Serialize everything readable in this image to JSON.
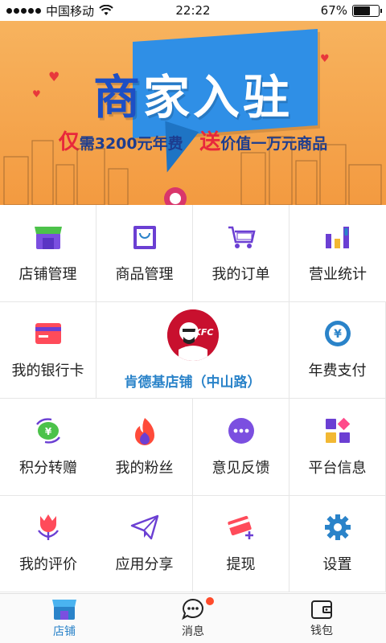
{
  "status_bar": {
    "carrier": "中国移动",
    "time": "22:22",
    "battery": "67%",
    "battery_level": 0.67
  },
  "banner": {
    "title_first": "商",
    "title_rest": "家入驻",
    "sub_mark1": "仅",
    "sub_text1": "需3200元年费",
    "sub_mark2": "送",
    "sub_text2": "价值一万元商品"
  },
  "grid": {
    "store_manage": "店铺管理",
    "goods_manage": "商品管理",
    "my_orders": "我的订单",
    "business_stats": "营业统计",
    "bank_card": "我的银行卡",
    "store_name": "肯德基店铺（中山路）",
    "store_logo_text": "KFC",
    "annual_fee": "年费支付",
    "points_transfer": "积分转赠",
    "my_fans": "我的粉丝",
    "feedback": "意见反馈",
    "platform_info": "平台信息",
    "my_reviews": "我的评价",
    "app_share": "应用分享",
    "withdraw": "提现",
    "settings": "设置"
  },
  "tabbar": {
    "store": "店铺",
    "messages": "消息",
    "wallet": "钱包"
  },
  "colors": {
    "accent_blue": "#2a83c9",
    "purple": "#6b3fd3",
    "banner_orange": "#f4a14b",
    "badge_red": "#ff4b2b"
  }
}
